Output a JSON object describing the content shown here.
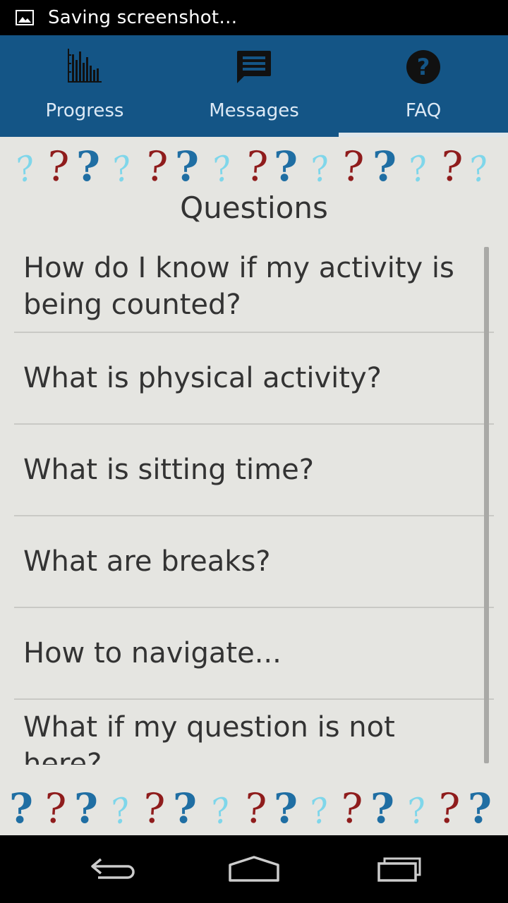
{
  "status_bar": {
    "notification_icon": "image-icon",
    "text": "Saving screenshot…"
  },
  "tabs": [
    {
      "label": "Progress",
      "icon": "bar-chart-icon",
      "active": false
    },
    {
      "label": "Messages",
      "icon": "message-icon",
      "active": false
    },
    {
      "label": "FAQ",
      "icon": "help-circle-icon",
      "active": true
    }
  ],
  "faq": {
    "title": "Questions",
    "items": [
      {
        "question": "How do I know if my activity is being counted?"
      },
      {
        "question": "What is physical activity?"
      },
      {
        "question": "What is sitting time?"
      },
      {
        "question": "What are breaks?"
      },
      {
        "question": "How to navigate..."
      },
      {
        "question": "What if my question is not here?"
      }
    ]
  },
  "nav_bar": {
    "buttons": [
      "back-icon",
      "home-icon",
      "recent-apps-icon"
    ]
  },
  "colors": {
    "tab_bar": "#145586",
    "background": "#e5e5e1",
    "question_red": "#8f1c1c",
    "question_blue": "#1f6ea3",
    "question_cyan": "#7fd6ea"
  }
}
